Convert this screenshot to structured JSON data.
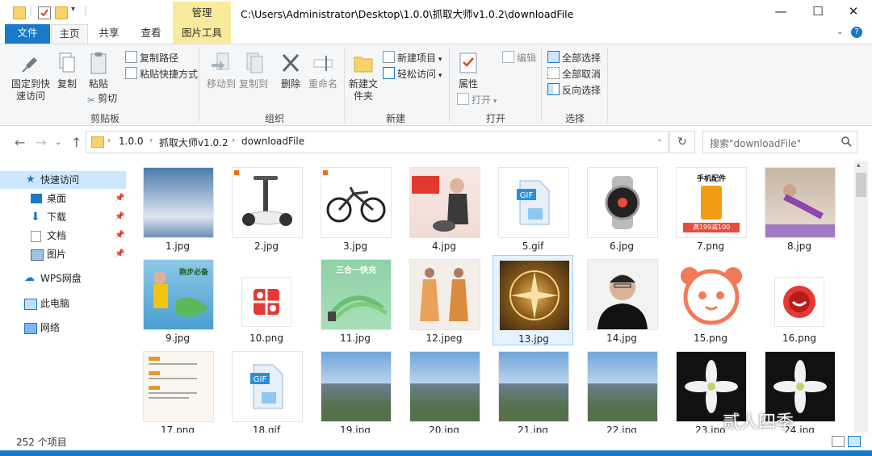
{
  "window": {
    "title": "C:\\Users\\Administrator\\Desktop\\1.0.0\\抓取大师v1.0.2\\downloadFile",
    "context_tab_header": "管理",
    "minimize": "—",
    "maximize": "☐",
    "close": "✕"
  },
  "ribbon_tabs": {
    "file": "文件",
    "home": "主页",
    "share": "共享",
    "view": "查看",
    "picture_tools": "图片工具"
  },
  "ribbon": {
    "clipboard": {
      "pin_quick_access": "固定到快速访问",
      "copy": "复制",
      "paste": "粘贴",
      "copy_path": "复制路径",
      "paste_shortcut": "粘贴快捷方式",
      "cut": "剪切",
      "label": "剪贴板"
    },
    "organize": {
      "move_to": "移动到",
      "copy_to": "复制到",
      "delete": "删除",
      "rename": "重命名",
      "label": "组织"
    },
    "new": {
      "new_folder": "新建文件夹",
      "new_item": "新建项目",
      "easy_access": "轻松访问",
      "label": "新建"
    },
    "open": {
      "properties": "属性",
      "open": "打开",
      "edit": "编辑",
      "label": "打开"
    },
    "select": {
      "select_all": "全部选择",
      "select_none": "全部取消",
      "invert": "反向选择",
      "label": "选择"
    }
  },
  "address": {
    "crumbs": [
      "1.0.0",
      "抓取大师v1.0.2",
      "downloadFile"
    ],
    "search_placeholder": "搜索\"downloadFile\""
  },
  "nav": {
    "items": [
      {
        "label": "快速访问",
        "icon": "star-icon"
      },
      {
        "label": "桌面",
        "icon": "desktop-icon"
      },
      {
        "label": "下载",
        "icon": "download-icon"
      },
      {
        "label": "文档",
        "icon": "document-icon"
      },
      {
        "label": "图片",
        "icon": "picture-icon"
      },
      {
        "label": "WPS网盘",
        "icon": "cloud-icon"
      },
      {
        "label": "此电脑",
        "icon": "computer-icon"
      },
      {
        "label": "网络",
        "icon": "network-icon"
      }
    ]
  },
  "files": [
    {
      "name": "1.jpg"
    },
    {
      "name": "2.jpg"
    },
    {
      "name": "3.jpg"
    },
    {
      "name": "4.jpg"
    },
    {
      "name": "5.gif"
    },
    {
      "name": "6.jpg"
    },
    {
      "name": "7.png"
    },
    {
      "name": "8.jpg"
    },
    {
      "name": "9.jpg"
    },
    {
      "name": "10.png"
    },
    {
      "name": "11.jpg"
    },
    {
      "name": "12.jpeg"
    },
    {
      "name": "13.jpg"
    },
    {
      "name": "14.jpg"
    },
    {
      "name": "15.png"
    },
    {
      "name": "16.png"
    },
    {
      "name": "17.png"
    },
    {
      "name": "18.gif"
    },
    {
      "name": "19.jpg"
    },
    {
      "name": "20.jpg"
    },
    {
      "name": "21.jpg"
    },
    {
      "name": "22.jpg"
    },
    {
      "name": "23.jpg"
    },
    {
      "name": "24.jpg"
    }
  ],
  "thumb_texts": {
    "t7_title": "手机配件",
    "t7_badge": "满199减100",
    "t9_a": "跑步必备",
    "t11": "三合一快充"
  },
  "status": {
    "count": "252 个项目"
  },
  "watermark": "贰人四季",
  "colors": {
    "accent": "#1979ca",
    "context_tab": "#f9eb9c",
    "selection": "#e5f3ff"
  }
}
